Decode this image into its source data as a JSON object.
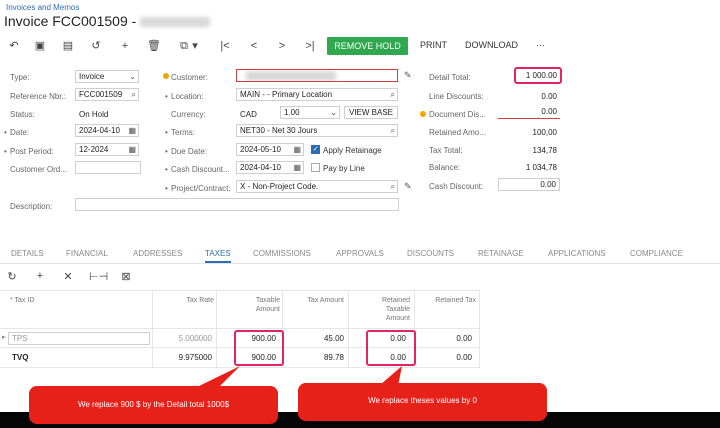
{
  "breadcrumb": "Invoices and Memos",
  "title": "Invoice FCC001509 -",
  "toolbar": {
    "remove_hold": "REMOVE HOLD",
    "print": "PRINT",
    "download": "DOWNLOAD",
    "more": "···"
  },
  "form": {
    "type_label": "Type:",
    "type_value": "Invoice",
    "ref_label": "Reference Nbr.:",
    "ref_value": "FCC001509",
    "status_label": "Status:",
    "status_value": "On Hold",
    "date_label": "Date:",
    "date_value": "2024-04-10",
    "post_label": "Post Period:",
    "post_value": "12-2024",
    "custord_label": "Customer Ord...",
    "desc_label": "Description:",
    "customer_label": "Customer:",
    "location_label": "Location:",
    "location_value": "MAIN    - - Primary Location",
    "currency_label": "Currency:",
    "currency_code": "CAD",
    "currency_rate": "1.00",
    "view_base": "VIEW BASE",
    "terms_label": "Terms:",
    "terms_value": "NET30 - Net 30 Jours",
    "due_label": "Due Date:",
    "due_value": "2024-05-10",
    "apply_retainage": "Apply Retainage",
    "cashdisc_label": "Cash Discount...",
    "cashdisc_value": "2024-04-10",
    "pay_by_line": "Pay by Line",
    "project_label": "Project/Contract:",
    "project_value": "X - Non-Project Code."
  },
  "totals": {
    "detail_total_label": "Detail Total:",
    "detail_total_value": "1 000.00",
    "line_disc_label": "Line Discounts:",
    "line_disc_value": "0.00",
    "doc_disc_label": "Document Dis...",
    "doc_disc_value": "0.00",
    "retained_label": "Retained Amo...",
    "retained_value": "100,00",
    "tax_total_label": "Tax Total:",
    "tax_total_value": "134,78",
    "balance_label": "Balance:",
    "balance_value": "1 034,78",
    "cash_disc_label": "Cash Discount:",
    "cash_disc_value": "0.00"
  },
  "tabs": [
    "DETAILS",
    "FINANCIAL",
    "ADDRESSES",
    "TAXES",
    "COMMISSIONS",
    "APPROVALS",
    "DISCOUNTS",
    "RETAINAGE",
    "APPLICATIONS",
    "COMPLIANCE"
  ],
  "grid": {
    "headers": {
      "tax_id": "* Tax ID",
      "tax_rate": "Tax Rate",
      "taxable_amount_1": "Taxable",
      "taxable_amount_2": "Amount",
      "tax_amount": "Tax Amount",
      "retained_taxable_1": "Retained",
      "retained_taxable_2": "Taxable",
      "retained_taxable_3": "Amount",
      "retained_tax": "Retained Tax"
    },
    "rows": [
      {
        "tax_id": "TPS",
        "tax_rate": "5.000000",
        "taxable": "900.00",
        "tax_amount": "45.00",
        "ret_taxable": "0.00",
        "ret_tax": "0.00"
      },
      {
        "tax_id": "TVQ",
        "tax_rate": "9.975000",
        "taxable": "900.00",
        "tax_amount": "89.78",
        "ret_taxable": "0.00",
        "ret_tax": "0.00"
      }
    ]
  },
  "annotations": {
    "left": "We replace 900 $ by the Detail total 1000$",
    "right": "We replace theses values by 0"
  },
  "colors": {
    "accent": "#2a6fb5",
    "hold_button": "#2fa84f",
    "highlight": "#e2245f",
    "callout": "#e8201a"
  }
}
